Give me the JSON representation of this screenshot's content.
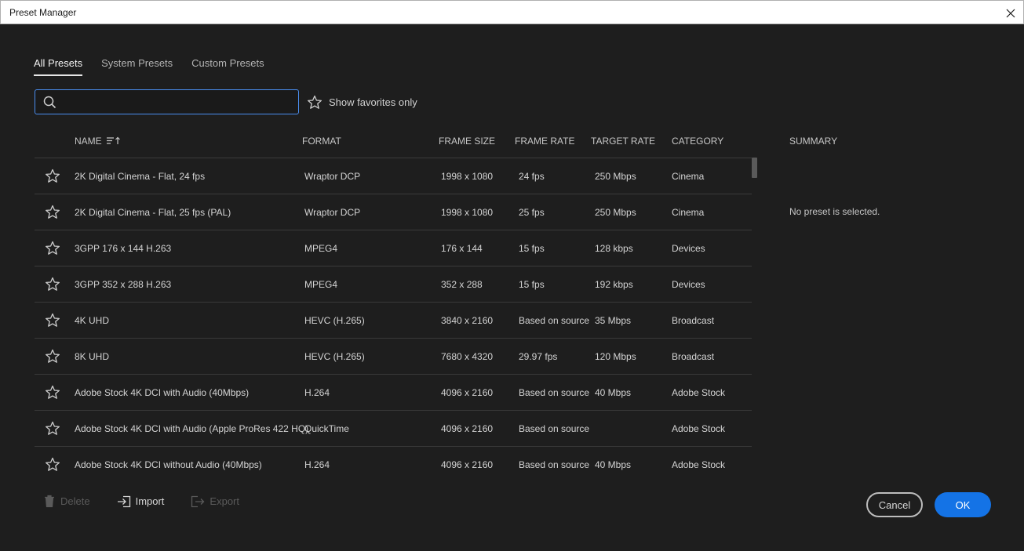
{
  "window": {
    "title": "Preset Manager",
    "close_icon": "close-icon"
  },
  "tabs": [
    {
      "label": "All Presets",
      "active": true
    },
    {
      "label": "System Presets",
      "active": false
    },
    {
      "label": "Custom Presets",
      "active": false
    }
  ],
  "search": {
    "value": "",
    "placeholder": ""
  },
  "favorites": {
    "label": "Show favorites only"
  },
  "columns": {
    "name": "NAME",
    "format": "FORMAT",
    "frame_size": "FRAME SIZE",
    "frame_rate": "FRAME RATE",
    "target_rate": "TARGET RATE",
    "category": "CATEGORY"
  },
  "rows": [
    {
      "name": "2K Digital Cinema - Flat, 24 fps",
      "format": "Wraptor DCP",
      "frame_size": "1998 x 1080",
      "frame_rate": "24 fps",
      "target_rate": "250 Mbps",
      "category": "Cinema"
    },
    {
      "name": "2K Digital Cinema - Flat, 25 fps (PAL)",
      "format": "Wraptor DCP",
      "frame_size": "1998 x 1080",
      "frame_rate": "25 fps",
      "target_rate": "250 Mbps",
      "category": "Cinema"
    },
    {
      "name": "3GPP 176 x 144 H.263",
      "format": "MPEG4",
      "frame_size": "176 x 144",
      "frame_rate": "15 fps",
      "target_rate": "128 kbps",
      "category": "Devices"
    },
    {
      "name": "3GPP 352 x 288 H.263",
      "format": "MPEG4",
      "frame_size": "352 x 288",
      "frame_rate": "15 fps",
      "target_rate": "192 kbps",
      "category": "Devices"
    },
    {
      "name": "4K UHD",
      "format": "HEVC (H.265)",
      "frame_size": "3840 x 2160",
      "frame_rate": "Based on source",
      "target_rate": "35 Mbps",
      "category": "Broadcast"
    },
    {
      "name": "8K UHD",
      "format": "HEVC (H.265)",
      "frame_size": "7680 x 4320",
      "frame_rate": "29.97 fps",
      "target_rate": "120 Mbps",
      "category": "Broadcast"
    },
    {
      "name": "Adobe Stock 4K DCI with Audio (40Mbps)",
      "format": "H.264",
      "frame_size": "4096 x 2160",
      "frame_rate": "Based on source",
      "target_rate": "40 Mbps",
      "category": "Adobe Stock"
    },
    {
      "name": "Adobe Stock 4K DCI with Audio (Apple ProRes 422 HQ)",
      "format": "QuickTime",
      "frame_size": "4096 x 2160",
      "frame_rate": "Based on source",
      "target_rate": "",
      "category": "Adobe Stock"
    },
    {
      "name": "Adobe Stock 4K DCI without Audio (40Mbps)",
      "format": "H.264",
      "frame_size": "4096 x 2160",
      "frame_rate": "Based on source",
      "target_rate": "40 Mbps",
      "category": "Adobe Stock"
    }
  ],
  "summary": {
    "header": "SUMMARY",
    "text": "No preset is selected."
  },
  "actions": {
    "delete": "Delete",
    "import": "Import",
    "export": "Export"
  },
  "buttons": {
    "cancel": "Cancel",
    "ok": "OK"
  },
  "colors": {
    "accent": "#1473e6",
    "background": "#1e1e1e",
    "focus": "#4a8ef0"
  }
}
